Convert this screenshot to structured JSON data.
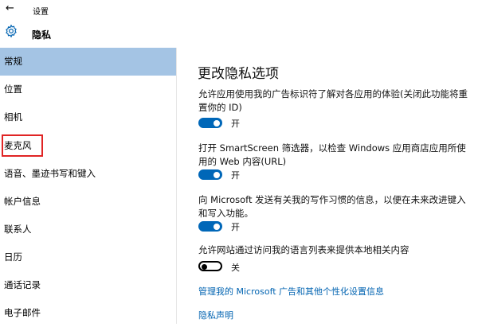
{
  "window": {
    "back_glyph": "←",
    "title": "设置"
  },
  "header": {
    "icon": "gear-icon",
    "title": "隐私"
  },
  "sidebar": {
    "selected_color": "#a4c4e4",
    "items": [
      {
        "label": "常规",
        "selected": true
      },
      {
        "label": "位置"
      },
      {
        "label": "相机"
      },
      {
        "label": "麦克风",
        "highlighted": true
      },
      {
        "label": "语音、墨迹书写和键入"
      },
      {
        "label": "帐户信息"
      },
      {
        "label": "联系人"
      },
      {
        "label": "日历"
      },
      {
        "label": "通话记录"
      },
      {
        "label": "电子邮件"
      }
    ]
  },
  "main": {
    "title": "更改隐私选项",
    "options": [
      {
        "text": "允许应用使用我的广告标识符了解对各应用的体验(关闭此功能将重置你的 ID)",
        "state": "on",
        "state_label": "开"
      },
      {
        "text": "打开 SmartScreen 筛选器，以检查 Windows 应用商店应用所使用的 Web 内容(URL)",
        "state": "on",
        "state_label": "开"
      },
      {
        "text": "向 Microsoft 发送有关我的写作习惯的信息，以便在未来改进键入和写入功能。",
        "state": "on",
        "state_label": "开"
      },
      {
        "text": "允许网站通过访问我的语言列表来提供本地相关内容",
        "state": "off",
        "state_label": "关"
      }
    ],
    "links": {
      "manage": "管理我的 Microsoft 广告和其他个性化设置信息",
      "privacy": "隐私声明"
    }
  },
  "colors": {
    "accent": "#0067b8",
    "link": "#0063b1",
    "highlight_border": "#e02424"
  }
}
